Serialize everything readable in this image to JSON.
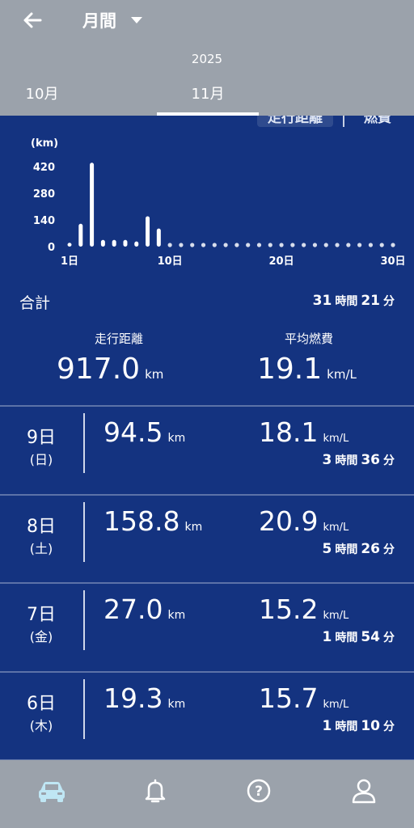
{
  "header": {
    "period": "月間",
    "back_icon": "arrow-left-icon"
  },
  "tabs": {
    "year": "2025",
    "items": [
      "10月",
      "11月"
    ],
    "selected": "11月"
  },
  "toggle": {
    "distance": "走行距離",
    "fuel": "燃費",
    "selected": "走行距離"
  },
  "chart_data": {
    "type": "bar",
    "ylabel": "(km)",
    "yticks": [
      "420",
      "280",
      "140",
      "0"
    ],
    "ylim": [
      0,
      420
    ],
    "xticks": [
      "1日",
      "10日",
      "20日",
      "30日"
    ],
    "x": [
      1,
      2,
      3,
      4,
      5,
      6,
      7,
      8,
      9,
      10,
      11,
      12,
      13,
      14,
      15,
      16,
      17,
      18,
      19,
      20,
      21,
      22,
      23,
      24,
      25,
      26,
      27,
      28,
      29,
      30
    ],
    "values": [
      20,
      120,
      440,
      35,
      35,
      35,
      27,
      159,
      95,
      0,
      0,
      0,
      0,
      0,
      0,
      0,
      0,
      0,
      0,
      0,
      0,
      0,
      0,
      0,
      0,
      0,
      0,
      0,
      0,
      0
    ],
    "bar_color": "#ffffff"
  },
  "summary": {
    "label": "合計",
    "time_hours": "31",
    "time_minutes": "21",
    "hour_unit": "時間",
    "minute_unit": "分",
    "distance_title": "走行距離",
    "distance_value": "917.0",
    "distance_unit": "km",
    "fuel_title": "平均燃費",
    "fuel_value": "19.1",
    "fuel_unit": "km/L"
  },
  "rows": [
    {
      "date": "9日",
      "dow": "(日)",
      "distance": "94.5",
      "fuel": "18.1",
      "hours": "3",
      "minutes": "36"
    },
    {
      "date": "8日",
      "dow": "(土)",
      "distance": "158.8",
      "fuel": "20.9",
      "hours": "5",
      "minutes": "26"
    },
    {
      "date": "7日",
      "dow": "(金)",
      "distance": "27.0",
      "fuel": "15.2",
      "hours": "1",
      "minutes": "54"
    },
    {
      "date": "6日",
      "dow": "(木)",
      "distance": "19.3",
      "fuel": "15.7",
      "hours": "1",
      "minutes": "10"
    }
  ],
  "units": {
    "km": "km",
    "kml": "km/L",
    "hour": "時間",
    "minute": "分"
  },
  "nav": [
    {
      "icon": "car-icon",
      "active": true
    },
    {
      "icon": "bell-icon",
      "active": false
    },
    {
      "icon": "help-icon",
      "active": false
    },
    {
      "icon": "user-icon",
      "active": false
    }
  ],
  "colors": {
    "bar_bg": "#9ba2ab",
    "panel": "#143380",
    "accent_active": "#bfe6f4"
  }
}
